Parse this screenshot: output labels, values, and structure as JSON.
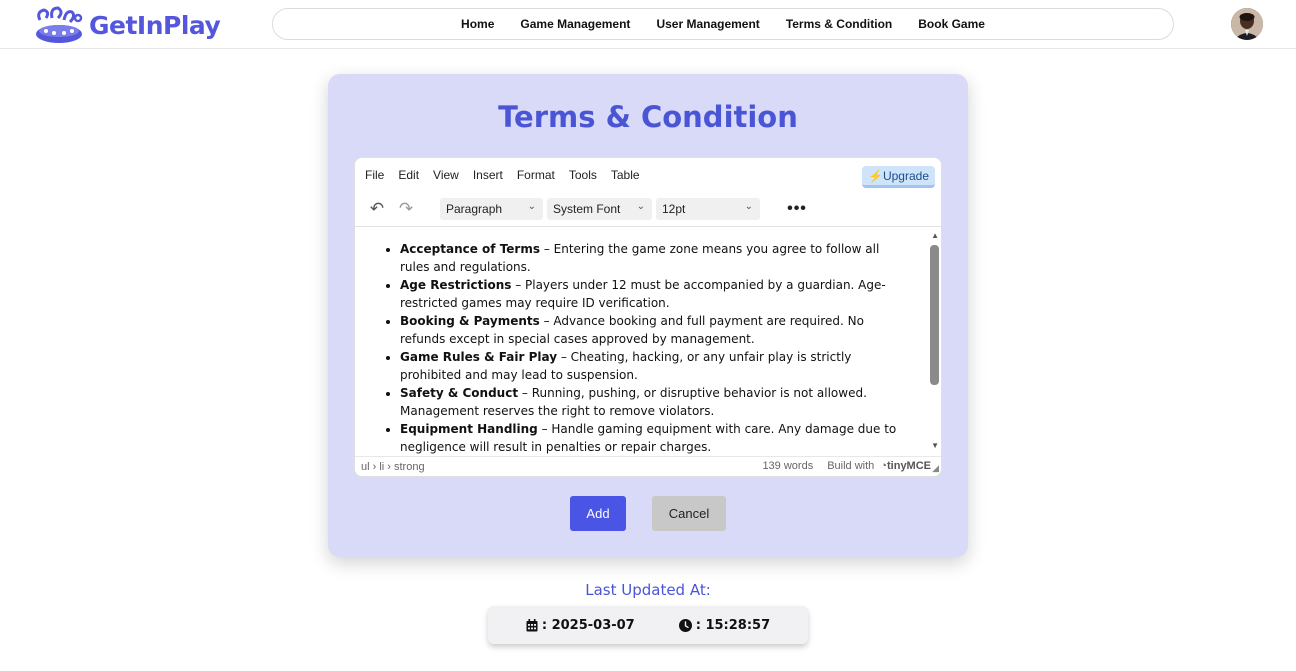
{
  "header": {
    "logo_text": "GetInPlay",
    "nav": [
      {
        "label": "Home"
      },
      {
        "label": "Game Management"
      },
      {
        "label": "User Management"
      },
      {
        "label": "Terms & Condition"
      },
      {
        "label": "Book Game"
      }
    ],
    "avatar_icon": "user-avatar"
  },
  "card": {
    "title": "Terms & Condition",
    "editor": {
      "menubar": [
        "File",
        "Edit",
        "View",
        "Insert",
        "Format",
        "Tools",
        "Table"
      ],
      "upgrade_label": "⚡Upgrade",
      "toolbar": {
        "undo_icon": "undo-icon",
        "redo_icon": "redo-icon",
        "block_format": "Paragraph",
        "font_family": "System Font",
        "font_size": "12pt",
        "more_icon": "more-icon"
      },
      "items": [
        {
          "term": "Acceptance of Terms",
          "text": " – Entering the game zone means you agree to follow all rules and regulations."
        },
        {
          "term": "Age Restrictions",
          "text": " – Players under 12 must be accompanied by a guardian. Age-restricted games may require ID verification."
        },
        {
          "term": "Booking & Payments",
          "text": " – Advance booking and full payment are required. No refunds except in special cases approved by management."
        },
        {
          "term": "Game Rules & Fair Play",
          "text": " – Cheating, hacking, or any unfair play is strictly prohibited and may lead to suspension."
        },
        {
          "term": "Safety & Conduct",
          "text": " – Running, pushing, or disruptive behavior is not allowed. Management reserves the right to remove violators."
        },
        {
          "term": "Equipment Handling",
          "text": " – Handle gaming equipment with care. Any damage due to negligence will result in penalties or repair charges."
        }
      ],
      "status_path": "ul › li › strong",
      "word_count": "139 words",
      "build_with": "Build with",
      "brand": "tinyMCE"
    },
    "add_label": "Add",
    "cancel_label": "Cancel"
  },
  "last_updated": {
    "label": "Last Updated At:",
    "date": ": 2025-03-07",
    "time": ": 15:28:57",
    "date_icon": "calendar-icon",
    "time_icon": "clock-icon"
  },
  "colors": {
    "accent": "#4a55d6",
    "card_bg": "#d9daf7",
    "add_button": "#4a55e6",
    "cancel_button": "#c8c8c8"
  }
}
